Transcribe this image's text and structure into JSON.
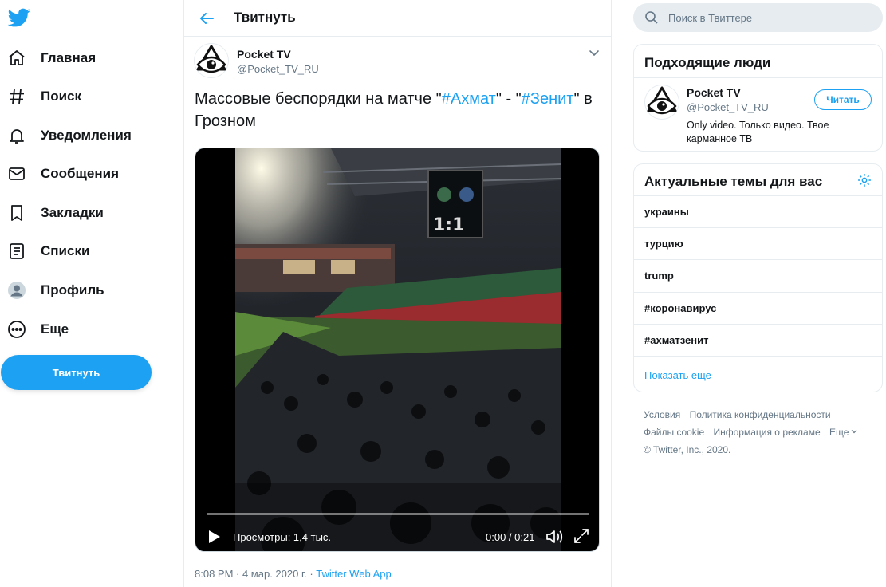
{
  "nav": {
    "items": [
      {
        "label": "Главная"
      },
      {
        "label": "Поиск"
      },
      {
        "label": "Уведомления"
      },
      {
        "label": "Сообщения"
      },
      {
        "label": "Закладки"
      },
      {
        "label": "Списки"
      },
      {
        "label": "Профиль"
      },
      {
        "label": "Еще"
      }
    ],
    "tweet_button": "Твитнуть"
  },
  "main": {
    "title": "Твитнуть",
    "tweet": {
      "name": "Pocket TV",
      "handle": "@Pocket_TV_RU",
      "text_part1": "Массовые беспорядки на матче \"",
      "hashtag1": "#Ахмат",
      "text_part2": "\" - \"",
      "hashtag2": "#Зенит",
      "text_part3": "\" в Грозном",
      "video": {
        "views": "Просмотры: 1,4 тыс.",
        "time": "0:00 / 0:21",
        "progress": 0
      },
      "timestamp": "8:08 PM · 4 мар. 2020 г. · ",
      "app": "Twitter Web App"
    }
  },
  "search": {
    "placeholder": "Поиск в Твиттере"
  },
  "who_to_follow": {
    "title": "Подходящие люди",
    "user": {
      "name": "Pocket TV",
      "handle": "@Pocket_TV_RU",
      "bio": "Only video. Только видео. Твое карманное ТВ",
      "follow_label": "Читать"
    }
  },
  "trends": {
    "title": "Актуальные темы для вас",
    "items": [
      {
        "label": "украины"
      },
      {
        "label": "турцию"
      },
      {
        "label": "trump"
      },
      {
        "label": "#коронавирус"
      },
      {
        "label": "#ахматзенит"
      }
    ],
    "show_more": "Показать еще"
  },
  "footer": {
    "links": [
      "Условия",
      "Политика конфиденциальности",
      "Файлы cookie",
      "Информация о рекламе",
      "Еще"
    ],
    "copyright": "© Twitter, Inc., 2020."
  },
  "colors": {
    "accent": "#1da1f2",
    "secondary_text": "#657786",
    "border": "#e6ecf0"
  }
}
